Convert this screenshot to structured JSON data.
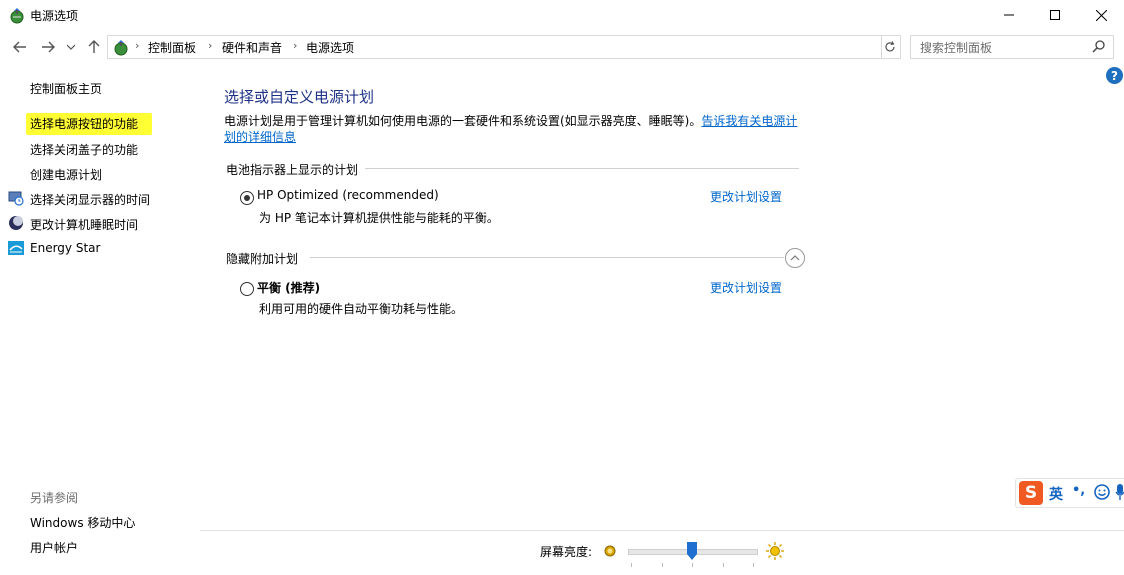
{
  "window": {
    "title": "电源选项"
  },
  "breadcrumb": [
    "控制面板",
    "硬件和声音",
    "电源选项"
  ],
  "search": {
    "placeholder": "搜索控制面板"
  },
  "left_nav": {
    "home": "控制面板主页",
    "items": [
      {
        "label": "选择电源按钮的功能",
        "highlighted": true,
        "icon": null
      },
      {
        "label": "选择关闭盖子的功能",
        "highlighted": false,
        "icon": null
      },
      {
        "label": "创建电源计划",
        "highlighted": false,
        "icon": null
      },
      {
        "label": "选择关闭显示器的时间",
        "highlighted": false,
        "icon": "monitor-clock-icon"
      },
      {
        "label": "更改计算机睡眠时间",
        "highlighted": false,
        "icon": "moon-icon"
      },
      {
        "label": "Energy Star",
        "highlighted": false,
        "icon": "energy-star-icon"
      }
    ],
    "see_also_title": "另请参阅",
    "see_also": [
      "Windows 移动中心",
      "用户帐户"
    ]
  },
  "main": {
    "title": "选择或自定义电源计划",
    "description": "电源计划是用于管理计算机如何使用电源的一套硬件和系统设置(如显示器亮度、睡眠等)。",
    "description_link": "告诉我有关电源计划的详细信息",
    "battery_section_title": "电池指示器上显示的计划",
    "hidden_section_title": "隐藏附加计划",
    "plans": [
      {
        "name": "HP Optimized (recommended)",
        "description": "为 HP 笔记本计算机提供性能与能耗的平衡。",
        "selected": true,
        "change_label": "更改计划设置"
      },
      {
        "name": "平衡 (推荐)",
        "description": "利用可用的硬件自动平衡功耗与性能。",
        "selected": false,
        "change_label": "更改计划设置"
      }
    ]
  },
  "brightness": {
    "label": "屏幕亮度:",
    "level": 0.5
  },
  "ime": {
    "logo": "S",
    "lang": "英",
    "punct": "•,"
  },
  "colors": {
    "title_blue": "#1e3287",
    "link_blue": "#0066cc",
    "highlight": "#ffff33"
  }
}
